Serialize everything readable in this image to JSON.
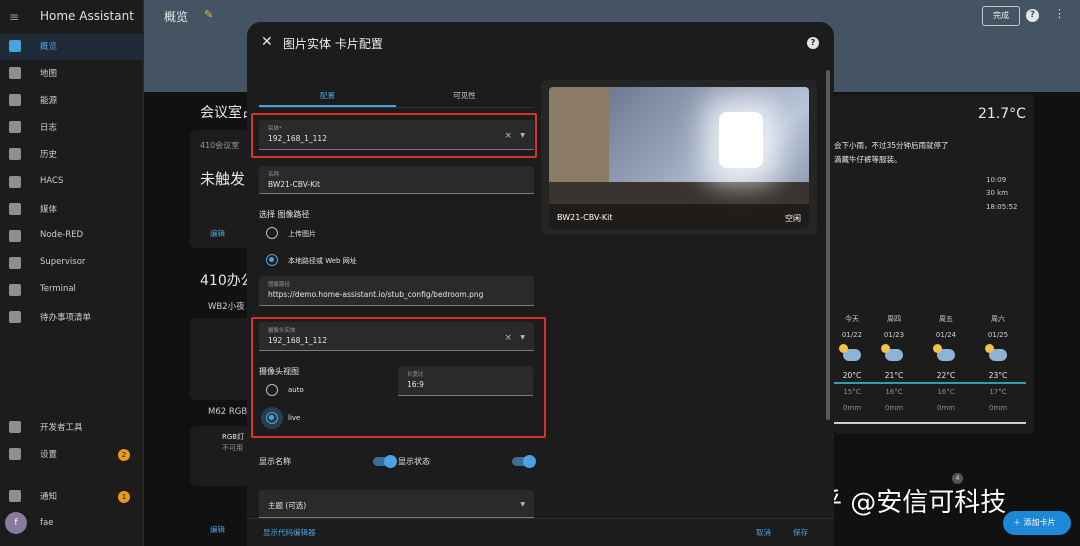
{
  "sidebar": {
    "menu_glyph": "≡",
    "title": "Home Assistant",
    "items": [
      {
        "label": "概览",
        "icon": "dashboard-icon"
      },
      {
        "label": "地图",
        "icon": "map-icon"
      },
      {
        "label": "能源",
        "icon": "lightning-icon"
      },
      {
        "label": "日志",
        "icon": "list-icon"
      },
      {
        "label": "历史",
        "icon": "chart-icon"
      },
      {
        "label": "HACS",
        "icon": "hacs-icon"
      },
      {
        "label": "媒体",
        "icon": "media-icon"
      },
      {
        "label": "Node-RED",
        "icon": "sitemap-icon"
      },
      {
        "label": "Supervisor",
        "icon": "home-assistant-icon"
      },
      {
        "label": "Terminal",
        "icon": "console-icon"
      },
      {
        "label": "待办事项清单",
        "icon": "clipboard-icon"
      }
    ],
    "bottom": [
      {
        "label": "开发者工具",
        "icon": "hammer-icon"
      },
      {
        "label": "设置",
        "icon": "cog-icon",
        "badge": "2"
      },
      {
        "label": "通知",
        "icon": "bell-icon",
        "badge": "1"
      }
    ],
    "user": {
      "initial": "f",
      "name": "fae"
    }
  },
  "topbar": {
    "title": "概览",
    "done_label": "完成",
    "help_glyph": "?",
    "more_glyph": "⋮"
  },
  "background": {
    "section1_title": "会议室占",
    "card1_sub": "410会议室",
    "card1_state": "未触发",
    "card1_action": "编辑",
    "section2_title": "410办公",
    "wb_label": "WB2小夜",
    "m62_label": "M62 RGB",
    "rgb_label": "RGB灯",
    "rgb_state": "不可用",
    "bottom_edit": "编辑",
    "temperature": "21.7°C",
    "weather_msg1": "会下小雨，不过35分钟后雨就停了",
    "weather_msg2": "滴藏牛仔裤等服装。",
    "sunrise": "10:09",
    "visibility": "30 km",
    "sunset": "18:05:52",
    "weather": [
      {
        "day": "今天",
        "date": "01/22",
        "hi": "20°C",
        "lo": "15°C",
        "rain": "0mm"
      },
      {
        "day": "周四",
        "date": "01/23",
        "hi": "21°C",
        "lo": "16°C",
        "rain": "0mm"
      },
      {
        "day": "周五",
        "date": "01/24",
        "hi": "22°C",
        "lo": "16°C",
        "rain": "0mm"
      },
      {
        "day": "周六",
        "date": "01/25",
        "hi": "23°C",
        "lo": "17°C",
        "rain": "0mm"
      }
    ],
    "counter_value": "4",
    "fab_label": "添加卡片",
    "watermark": "知乎 @安信可科技"
  },
  "dialog": {
    "title": "图片实体 卡片配置",
    "close_glyph": "✕",
    "help_glyph": "?",
    "tabs": [
      "配置",
      "可见性"
    ],
    "entity_field": {
      "label": "实体*",
      "value": "192_168_1_112"
    },
    "name_field": {
      "label": "名称",
      "value": "BW21-CBV-Kit"
    },
    "image_path_section": "选择 图像路径",
    "radio_upload": "上传图片",
    "radio_local": "本地路径或 Web 网址",
    "image_path_field": {
      "label": "图像路径",
      "value": "https://demo.home-assistant.io/stub_config/bedroom.png"
    },
    "camera_field": {
      "label": "摄像头实体",
      "value": "192_168_1_112"
    },
    "camera_view_section": "摄像头视图",
    "radio_auto": "auto",
    "radio_live": "live",
    "aspect_field": {
      "label": "长宽比",
      "value": "16:9"
    },
    "show_name": "显示名称",
    "show_state": "显示状态",
    "theme_field": {
      "label": "",
      "value": "主题 (可选)"
    },
    "preview_name": "BW21-CBV-Kit",
    "preview_state": "空闲",
    "footer_code": "显示代码编辑器",
    "footer_cancel": "取消",
    "footer_save": "保存"
  },
  "colors": {
    "accent": "#4aa3df",
    "highlight_box": "#d8322d",
    "header": "#445463"
  }
}
